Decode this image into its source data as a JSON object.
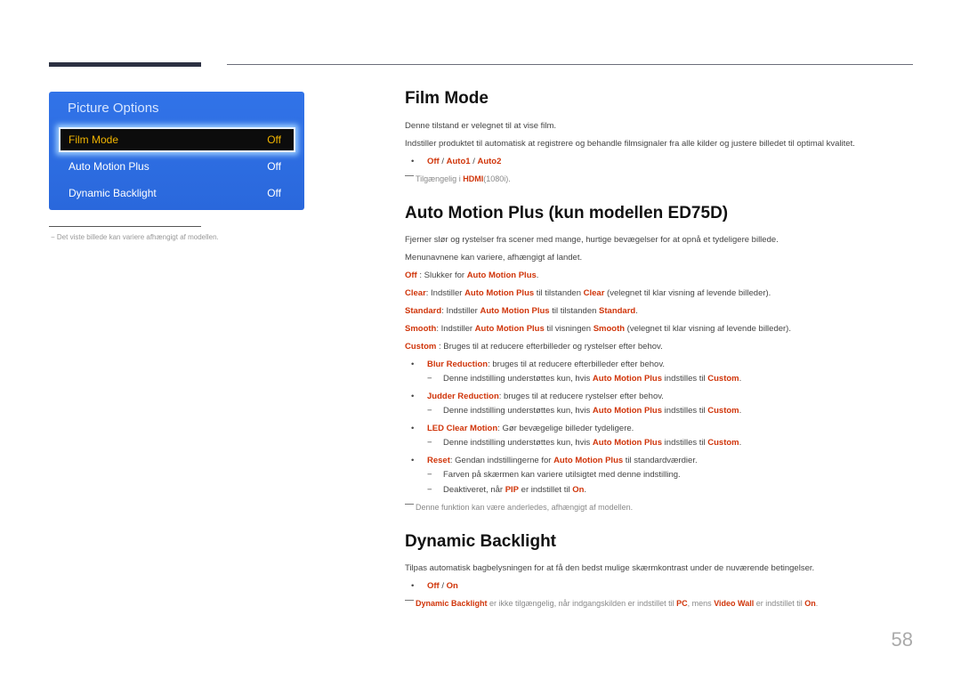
{
  "menu": {
    "title": "Picture Options",
    "items": [
      {
        "label": "Film Mode",
        "value": "Off",
        "selected": true
      },
      {
        "label": "Auto Motion Plus",
        "value": "Off",
        "selected": false
      },
      {
        "label": "Dynamic Backlight",
        "value": "Off",
        "selected": false
      }
    ]
  },
  "left_note": "−  Det viste billede kan variere afhængigt af modellen.",
  "film_mode": {
    "heading": "Film Mode",
    "p1": "Denne tilstand er velegnet til at vise film.",
    "p2": "Indstiller produktet til automatisk at registrere og behandle filmsignaler fra alle kilder og justere billedet til optimal kvalitet.",
    "options": [
      "Off",
      "Auto1",
      "Auto2"
    ],
    "note_pre": "Tilgængelig i ",
    "note_hl": "HDMI",
    "note_post": "(1080i)."
  },
  "auto_motion": {
    "heading": "Auto Motion Plus (kun modellen ED75D)",
    "p1": "Fjerner slør og rystelser fra scener med mange, hurtige bevægelser for at opnå et tydeligere billede.",
    "p2": "Menunavnene kan variere, afhængigt af landet.",
    "off_label": "Off",
    "off_text": " : Slukker for ",
    "amp": "Auto Motion Plus",
    "clear_label": "Clear",
    "clear_t1": ": Indstiller ",
    "clear_t2": " til tilstanden ",
    "clear_t3": " (velegnet til klar visning af levende billeder).",
    "standard_label": "Standard",
    "standard_t1": ": Indstiller ",
    "standard_t2": " til tilstanden ",
    "smooth_label": "Smooth",
    "smooth_t1": ": Indstiller ",
    "smooth_t2": " til visningen ",
    "smooth_t3": " (velegnet til klar visning af levende billeder).",
    "custom_label": "Custom",
    "custom_text": " : Bruges til at reducere efterbilleder og rystelser efter behov.",
    "blur_label": "Blur Reduction",
    "blur_text": ": bruges til at reducere efterbilleder efter behov.",
    "judder_label": "Judder Reduction",
    "judder_text": ": bruges til at reducere rystelser efter behov.",
    "led_label": "LED Clear Motion",
    "led_text": ": Gør bevægelige billeder tydeligere.",
    "support_t1": "Denne indstilling understøttes kun, hvis ",
    "support_t2": " indstilles til ",
    "reset_label": "Reset",
    "reset_t1": ": Gendan indstillingerne for ",
    "reset_t2": " til standardværdier.",
    "reset_sub1": "Farven på skærmen kan variere utilsigtet med denne indstilling.",
    "reset_sub2_t1": "Deaktiveret, når ",
    "pip": "PIP",
    "reset_sub2_t2": " er indstillet til ",
    "on": "On",
    "footnote": "Denne funktion kan være anderledes, afhængigt af modellen."
  },
  "dynamic_backlight": {
    "heading": "Dynamic Backlight",
    "p1": "Tilpas automatisk bagbelysningen for at få den bedst mulige skærmkontrast under de nuværende betingelser.",
    "options": [
      "Off",
      "On"
    ],
    "note_hl1": "Dynamic Backlight",
    "note_t1": " er ikke tilgængelig, når indgangskilden er indstillet til ",
    "note_hl2": "PC",
    "note_t2": ", mens ",
    "note_hl3": "Video Wall",
    "note_t3": " er indstillet til ",
    "note_hl4": "On",
    "note_t4": "."
  },
  "page_number": "58",
  "sep": " / ",
  "dot": "•",
  "dash": "−",
  "period": "."
}
